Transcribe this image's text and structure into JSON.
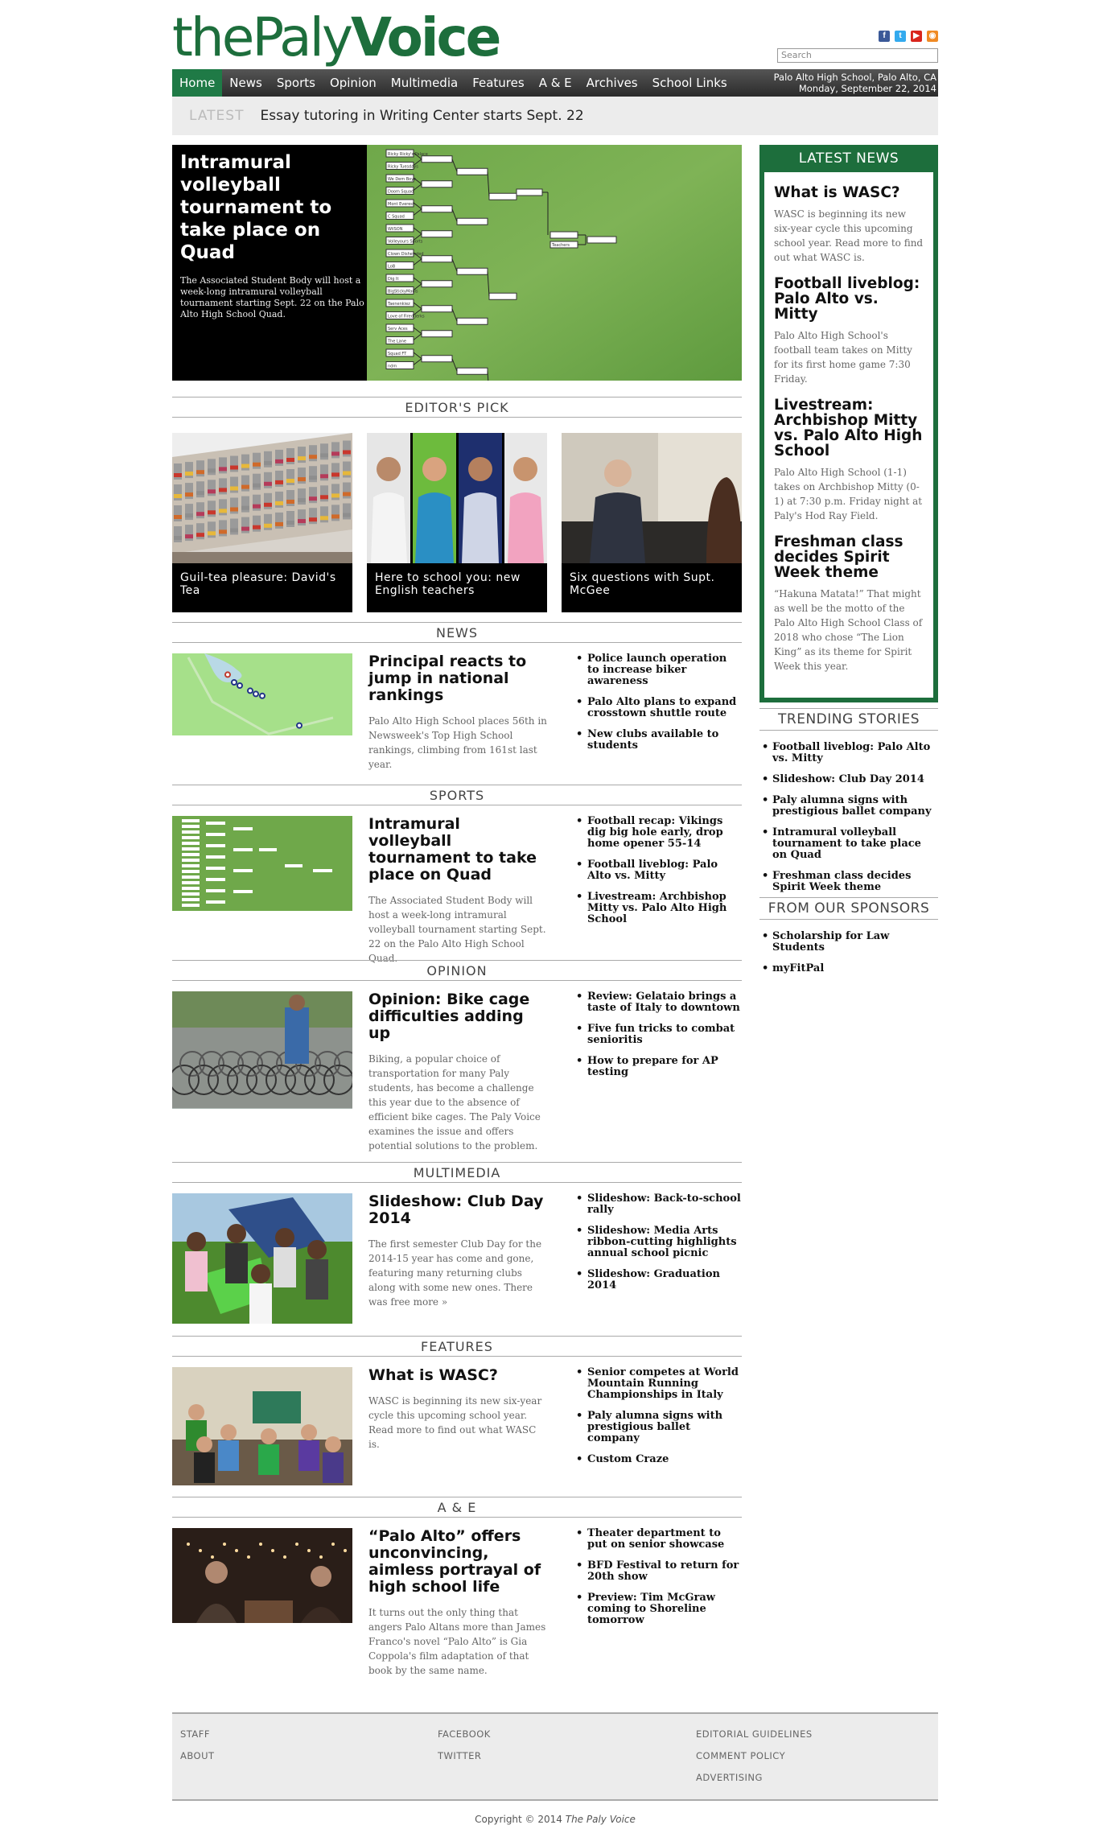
{
  "masthead": {
    "logo_part1": "the",
    "logo_part2": "Paly",
    "logo_part3": "Voice",
    "search_placeholder": "Search"
  },
  "social": [
    {
      "icon": "facebook-icon",
      "glyph": "f",
      "color": "#3b5998"
    },
    {
      "icon": "twitter-icon",
      "glyph": "t",
      "color": "#33aaee"
    },
    {
      "icon": "youtube-icon",
      "glyph": "▶",
      "color": "#d9251d"
    },
    {
      "icon": "rss-icon",
      "glyph": "◉",
      "color": "#f08a24"
    }
  ],
  "nav": {
    "items": [
      "Home",
      "News",
      "Sports",
      "Opinion",
      "Multimedia",
      "Features",
      "A & E",
      "Archives",
      "School Links"
    ],
    "location": "Palo Alto High School, Palo Alto, CA",
    "date": "Monday, September 22, 2014"
  },
  "latest": {
    "label": "LATEST",
    "text": "Essay tutoring in Writing Center starts Sept. 22"
  },
  "feature": {
    "title": "Intramural volleyball tournament to take place on Quad",
    "desc": "The Associated Student Body will host a week-long intramural volleyball tournament starting Sept. 22 on the Palo Alto High School Quad."
  },
  "editors_pick": {
    "heading": "EDITOR'S PICK",
    "items": [
      {
        "label": "Guil-tea pleasure: David's Tea"
      },
      {
        "label": "Here to school you: new English teachers"
      },
      {
        "label": "Six questions with Supt. McGee"
      }
    ]
  },
  "sections": {
    "news": {
      "heading": "NEWS",
      "title": "Principal reacts to jump in national rankings",
      "desc": "Palo Alto High School places 56th in Newsweek's Top High School rankings, climbing from 161st last year.",
      "links": [
        "Police launch operation to increase biker awareness",
        "Palo Alto plans to expand crosstown shuttle route",
        "New clubs available to students"
      ]
    },
    "sports": {
      "heading": "SPORTS",
      "title": "Intramural volleyball tournament to take place on Quad",
      "desc": "The Associated Student Body will host a week-long intramural volleyball tournament starting Sept. 22 on the Palo Alto High School Quad.",
      "links": [
        "Football recap: Vikings dig big hole early, drop home opener 55-14",
        "Football liveblog: Palo Alto vs. Mitty",
        "Livestream: Archbishop Mitty vs. Palo Alto High School"
      ]
    },
    "opinion": {
      "heading": "OPINION",
      "title": "Opinion: Bike cage difficulties adding up",
      "desc": "Biking, a popular choice of transportation for many Paly students, has become a challenge this year due to the absence of efficient bike cages. The Paly Voice examines the issue and offers potential solutions to the problem.",
      "links": [
        "Review: Gelataio brings a taste of Italy to downtown",
        "Five fun tricks to combat senioritis",
        "How to prepare for AP testing"
      ]
    },
    "multimedia": {
      "heading": "MULTIMEDIA",
      "title": "Slideshow: Club Day 2014",
      "desc": "The first semester Club Day for the 2014-15 year has come and gone, featuring many returning clubs along with some new ones. There was free more »",
      "links": [
        "Slideshow: Back-to-school rally",
        "Slideshow: Media Arts ribbon-cutting highlights annual school picnic",
        "Slideshow: Graduation 2014"
      ]
    },
    "features": {
      "heading": "FEATURES",
      "title": "What is WASC?",
      "desc": "WASC is beginning its new six-year cycle this upcoming school year. Read more to find out what WASC is.",
      "links": [
        "Senior competes at World Mountain Running Championships in Italy",
        "Paly alumna signs with prestigious ballet company",
        "Custom Craze"
      ]
    },
    "ae": {
      "heading": "A & E",
      "title": "“Palo Alto” offers unconvincing, aimless portrayal of high school life",
      "desc": "It turns out the only thing that angers Palo Altans more than James Franco's novel “Palo Alto” is Gia Coppola's film adaptation of that book by the same name.",
      "links": [
        "Theater department to put on senior showcase",
        "BFD Festival to return for 20th show",
        "Preview: Tim McGraw coming to Shoreline tomorrow"
      ]
    }
  },
  "latest_news": {
    "heading": "LATEST NEWS",
    "items": [
      {
        "title": "What is WASC?",
        "desc": "WASC is beginning its new six-year cycle this upcoming school year. Read more to find out what WASC is."
      },
      {
        "title": "Football liveblog: Palo Alto vs. Mitty",
        "desc": "Palo Alto High School's football team takes on Mitty for its first home game 7:30 Friday."
      },
      {
        "title": "Livestream: Archbishop Mitty vs. Palo Alto High School",
        "desc": "Palo Alto High School (1-1) takes on Archbishop Mitty (0-1) at 7:30 p.m. Friday night at Paly's Hod Ray Field."
      },
      {
        "title": "Freshman class decides Spirit Week theme",
        "desc": "“Hakuna Matata!” That might as well be the motto of the Palo Alto High School Class of 2018 who chose “The Lion King” as its theme for Spirit Week this year."
      }
    ]
  },
  "trending": {
    "heading": "TRENDING STORIES",
    "items": [
      "Football liveblog: Palo Alto vs. Mitty",
      "Slideshow: Club Day 2014",
      "Paly alumna signs with prestigious ballet company",
      "Intramural volleyball tournament to take place on Quad",
      "Freshman class decides Spirit Week theme"
    ]
  },
  "sponsors": {
    "heading": "FROM OUR SPONSORS",
    "items": [
      "Scholarship for Law Students",
      "myFitPal"
    ]
  },
  "footer": {
    "col1": [
      "STAFF",
      "ABOUT"
    ],
    "col2": [
      "FACEBOOK",
      "TWITTER"
    ],
    "col3": [
      "EDITORIAL GUIDELINES",
      "COMMENT POLICY",
      "ADVERTISING"
    ],
    "copyright_prefix": "Copyright © 2014",
    "copyright_name": "The Paly Voice"
  },
  "bracket_labels": [
    "Ricky Ricky's Palace",
    "Ricky Tuesdays",
    "We Dem Boyz",
    "Doom Squad",
    "Mont Everest",
    "C Squad",
    "WilSON",
    "Volleyours Sports",
    "Clown Disheveled",
    "LoB",
    "Dig It",
    "BigStickyMauls",
    "Taenenkiez",
    "Love of Fired Jerks",
    "Serv Aces",
    "The Lane",
    "Squad FT",
    "ndm",
    "Teachers"
  ]
}
